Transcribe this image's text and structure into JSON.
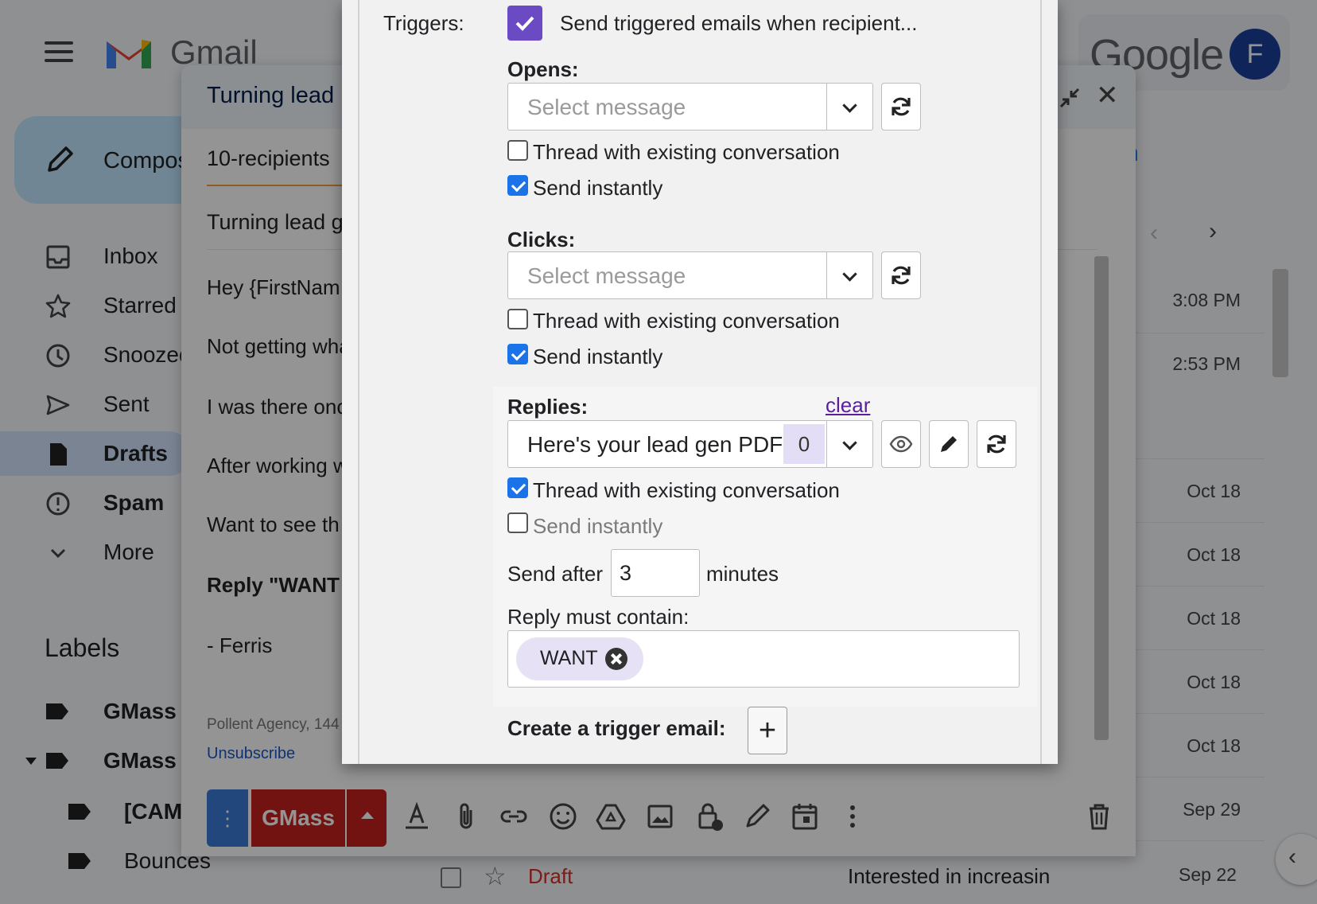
{
  "gmail": {
    "wordmark": "Gmail",
    "google_wordmark": "Google",
    "avatar_initial": "F",
    "compose_label": "Compose",
    "nav": [
      {
        "label": "Inbox",
        "icon": "inbox-icon"
      },
      {
        "label": "Starred",
        "icon": "star-icon"
      },
      {
        "label": "Snoozed",
        "icon": "clock-icon"
      },
      {
        "label": "Sent",
        "icon": "send-icon"
      },
      {
        "label": "Drafts",
        "icon": "draft-icon"
      },
      {
        "label": "Spam",
        "icon": "spam-icon"
      },
      {
        "label": "More",
        "icon": "chevron-down-icon"
      }
    ],
    "labels_title": "Labels",
    "labels": [
      "GMass",
      "GMass",
      "[CAM",
      "Bounces"
    ],
    "search_fragment": "ch",
    "mail_dates": [
      "3:08 PM",
      "2:53 PM",
      "Oct 18",
      "Oct 18",
      "Oct 18",
      "Oct 18",
      "Oct 18",
      "Sep 29"
    ],
    "draft_row": {
      "label": "Draft",
      "snippet": "Interested in increasin",
      "date": "Sep 22"
    }
  },
  "compose": {
    "title": "Turning lead",
    "to": "10-recipients",
    "subject": "Turning lead g",
    "body_lines": [
      "Hey {FirstNam",
      "Not getting wha",
      "I was there onc",
      "After working w",
      "Want to see th"
    ],
    "body_bold": "Reply \"WANT",
    "signoff": "- Ferris",
    "footer": "Pollent Agency, 144",
    "unsubscribe": "Unsubscribe",
    "send_button": "GMass",
    "send_dots": "⋮"
  },
  "panel": {
    "triggers_label": "Triggers:",
    "triggers_check_label": "Send triggered emails when recipient...",
    "opens": {
      "title": "Opens:",
      "placeholder": "Select message",
      "thread_label": "Thread with existing conversation",
      "thread_checked": false,
      "instant_label": "Send instantly",
      "instant_checked": true
    },
    "clicks": {
      "title": "Clicks:",
      "placeholder": "Select message",
      "thread_label": "Thread with existing conversation",
      "thread_checked": false,
      "instant_label": "Send instantly",
      "instant_checked": true
    },
    "replies": {
      "title": "Replies:",
      "clear": "clear",
      "selected": "Here's your lead gen PDF",
      "count": "0",
      "thread_label": "Thread with existing conversation",
      "thread_checked": true,
      "instant_label": "Send instantly",
      "instant_checked": false,
      "send_after_label": "Send after",
      "send_after_value": "3",
      "minutes_label": "minutes",
      "contain_label": "Reply must contain:",
      "tags": [
        "WANT"
      ]
    },
    "create_label": "Create a trigger email:"
  },
  "colors": {
    "gmass_red": "#c5221f",
    "gmass_blue": "#3b7bd6",
    "accent_purple": "#6a4bc4",
    "link_purple": "#5a1fa0",
    "checkbox_blue": "#1a73e8"
  }
}
